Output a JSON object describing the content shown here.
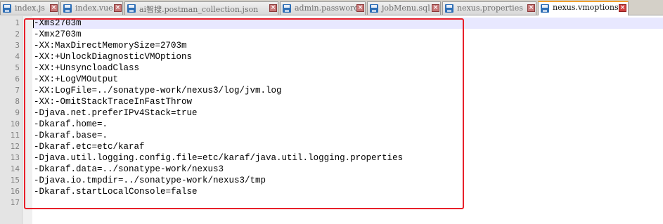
{
  "tabs": [
    {
      "label": "index.js",
      "active": false
    },
    {
      "label": "index.vue",
      "active": false
    },
    {
      "label": "ai智搜.postman_collection.json",
      "active": false
    },
    {
      "label": "admin.password",
      "active": false
    },
    {
      "label": "jobMenu.sql",
      "active": false
    },
    {
      "label": "nexus.properties",
      "active": false
    },
    {
      "label": "nexus.vmoptions",
      "active": true
    }
  ],
  "editor": {
    "line_numbers": [
      "1",
      "2",
      "3",
      "4",
      "5",
      "6",
      "7",
      "8",
      "9",
      "10",
      "11",
      "12",
      "13",
      "14",
      "15",
      "16",
      "17"
    ],
    "lines": [
      "-Xms2703m",
      "-Xmx2703m",
      "-XX:MaxDirectMemorySize=2703m",
      "-XX:+UnlockDiagnosticVMOptions",
      "-XX:+UnsyncloadClass",
      "-XX:+LogVMOutput",
      "-XX:LogFile=../sonatype-work/nexus3/log/jvm.log",
      "-XX:-OmitStackTraceInFastThrow",
      "-Djava.net.preferIPv4Stack=true",
      "-Dkaraf.home=.",
      "-Dkaraf.base=.",
      "-Dkaraf.etc=etc/karaf",
      "-Djava.util.logging.config.file=etc/karaf/java.util.logging.properties",
      "-Dkaraf.data=../sonatype-work/nexus3",
      "-Djava.io.tmpdir=../sonatype-work/nexus3/tmp",
      "-Dkaraf.startLocalConsole=false",
      ""
    ]
  },
  "icons": {
    "tab_icon": "save-icon",
    "tab_close": "close-icon"
  },
  "colors": {
    "highlight_box": "#e8202a",
    "active_tab_accent": "#f0a030",
    "current_line": "#e8e8ff"
  }
}
